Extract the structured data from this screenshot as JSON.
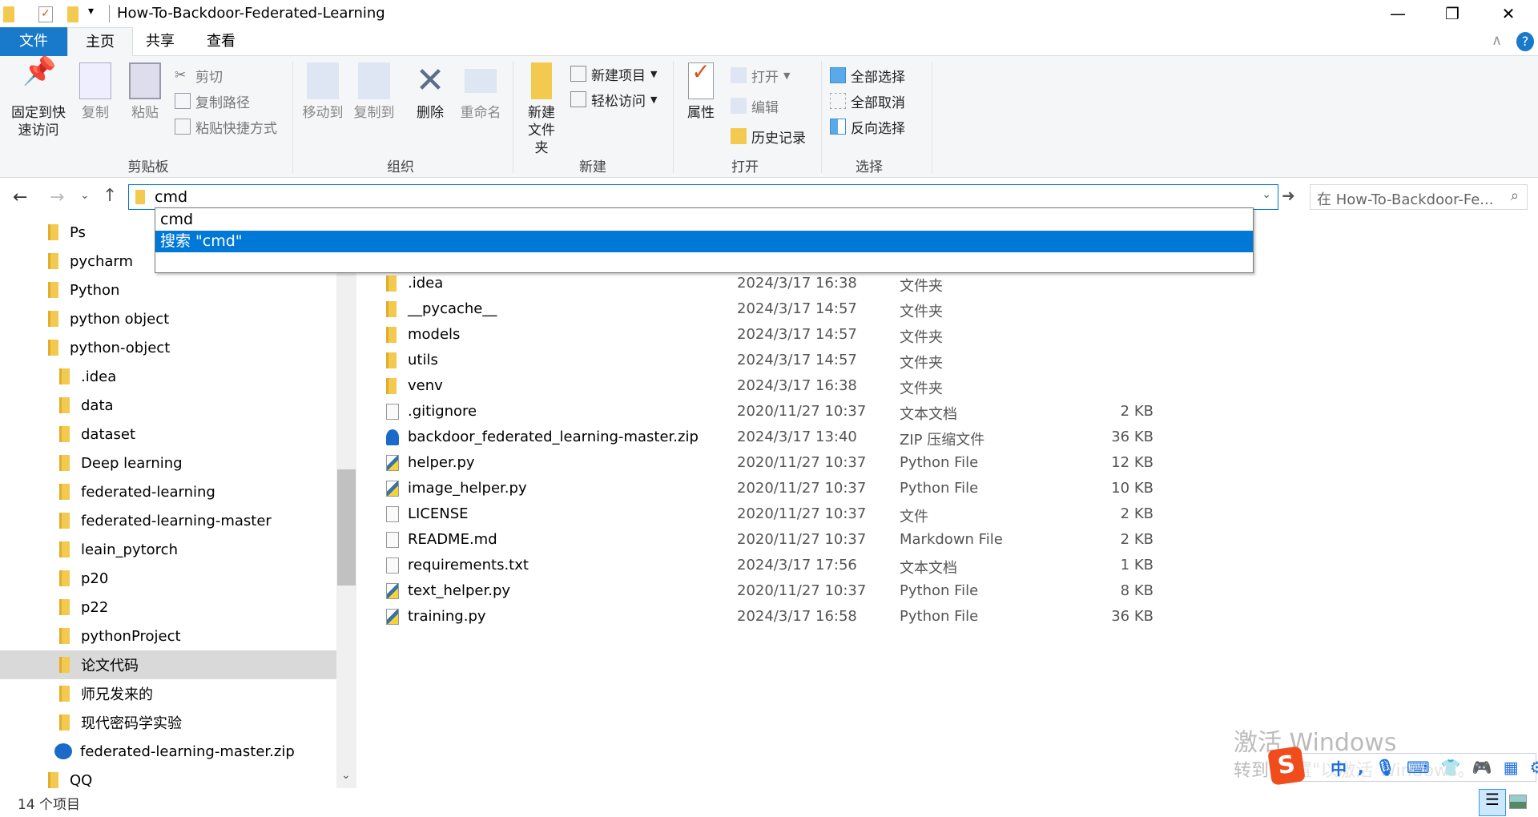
{
  "window": {
    "title": "How-To-Backdoor-Federated-Learning",
    "minimize": "—",
    "restore": "❐",
    "close": "✕"
  },
  "tabs": [
    {
      "label": "文件"
    },
    {
      "label": "主页"
    },
    {
      "label": "共享"
    },
    {
      "label": "查看"
    }
  ],
  "ribbon": {
    "clipboard": {
      "label": "剪贴板",
      "pin": "固定到快速访问",
      "copy": "复制",
      "paste": "粘贴",
      "cut": "剪切",
      "copy_path": "复制路径",
      "paste_shortcut": "粘贴快捷方式"
    },
    "organize": {
      "label": "组织",
      "move_to": "移动到",
      "copy_to": "复制到",
      "delete": "删除",
      "rename": "重命名"
    },
    "new": {
      "label": "新建",
      "new_folder": "新建文件夹",
      "new_item": "新建项目",
      "easy_access": "轻松访问"
    },
    "open": {
      "label": "打开",
      "properties": "属性",
      "open": "打开",
      "edit": "编辑",
      "history": "历史记录"
    },
    "select": {
      "label": "选择",
      "select_all": "全部选择",
      "select_none": "全部取消",
      "invert": "反向选择"
    }
  },
  "address": {
    "value": "cmd",
    "search_placeholder": "在 How-To-Backdoor-Fe..."
  },
  "dropdown": [
    {
      "label": "cmd"
    },
    {
      "label": "搜索 \"cmd\""
    }
  ],
  "nav": [
    {
      "label": "Ps",
      "indent": 0
    },
    {
      "label": "pycharm",
      "indent": 0
    },
    {
      "label": "Python",
      "indent": 0
    },
    {
      "label": "python  object",
      "indent": 0
    },
    {
      "label": "python-object",
      "indent": 0
    },
    {
      "label": ".idea",
      "indent": 1
    },
    {
      "label": "data",
      "indent": 1
    },
    {
      "label": "dataset",
      "indent": 1
    },
    {
      "label": "Deep learning",
      "indent": 1
    },
    {
      "label": "federated-learning",
      "indent": 1
    },
    {
      "label": "federated-learning-master",
      "indent": 1
    },
    {
      "label": "leain_pytorch",
      "indent": 1
    },
    {
      "label": "p20",
      "indent": 1
    },
    {
      "label": "p22",
      "indent": 1
    },
    {
      "label": "pythonProject",
      "indent": 1
    },
    {
      "label": "论文代码",
      "indent": 1,
      "selected": true
    },
    {
      "label": "师兄发来的",
      "indent": 1
    },
    {
      "label": "现代密码学实验",
      "indent": 1
    },
    {
      "label": "federated-learning-master.zip",
      "indent": 1,
      "zip": true
    },
    {
      "label": "QQ",
      "indent": 0
    }
  ],
  "files": [
    {
      "name": ".idea",
      "date": "2024/3/17 16:38",
      "type": "文件夹",
      "size": "",
      "icon": "folder"
    },
    {
      "name": "__pycache__",
      "date": "2024/3/17 14:57",
      "type": "文件夹",
      "size": "",
      "icon": "folder"
    },
    {
      "name": "models",
      "date": "2024/3/17 14:57",
      "type": "文件夹",
      "size": "",
      "icon": "folder"
    },
    {
      "name": "utils",
      "date": "2024/3/17 14:57",
      "type": "文件夹",
      "size": "",
      "icon": "folder"
    },
    {
      "name": "venv",
      "date": "2024/3/17 16:38",
      "type": "文件夹",
      "size": "",
      "icon": "folder"
    },
    {
      "name": ".gitignore",
      "date": "2020/11/27 10:37",
      "type": "文本文档",
      "size": "2 KB",
      "icon": "doc"
    },
    {
      "name": "backdoor_federated_learning-master.zip",
      "date": "2024/3/17 13:40",
      "type": "ZIP 压缩文件",
      "size": "36 KB",
      "icon": "zip"
    },
    {
      "name": "helper.py",
      "date": "2020/11/27 10:37",
      "type": "Python File",
      "size": "12 KB",
      "icon": "py"
    },
    {
      "name": "image_helper.py",
      "date": "2020/11/27 10:37",
      "type": "Python File",
      "size": "10 KB",
      "icon": "py"
    },
    {
      "name": "LICENSE",
      "date": "2020/11/27 10:37",
      "type": "文件",
      "size": "2 KB",
      "icon": "doc"
    },
    {
      "name": "README.md",
      "date": "2020/11/27 10:37",
      "type": "Markdown File",
      "size": "2 KB",
      "icon": "doc"
    },
    {
      "name": "requirements.txt",
      "date": "2024/3/17 17:56",
      "type": "文本文档",
      "size": "1 KB",
      "icon": "doc"
    },
    {
      "name": "text_helper.py",
      "date": "2020/11/27 10:37",
      "type": "Python File",
      "size": "8 KB",
      "icon": "py"
    },
    {
      "name": "training.py",
      "date": "2024/3/17 16:58",
      "type": "Python File",
      "size": "36 KB",
      "icon": "py"
    }
  ],
  "status": {
    "count": "14 个项目"
  },
  "watermark": {
    "line1": "激活 Windows",
    "line2": "转到\"设置\"以激活 Windows。"
  },
  "ime": {
    "logo": "S",
    "mode": "中"
  },
  "colors": {
    "accent": "#0078d7",
    "file_tab": "#1979ca",
    "folder": "#f3c94f"
  }
}
